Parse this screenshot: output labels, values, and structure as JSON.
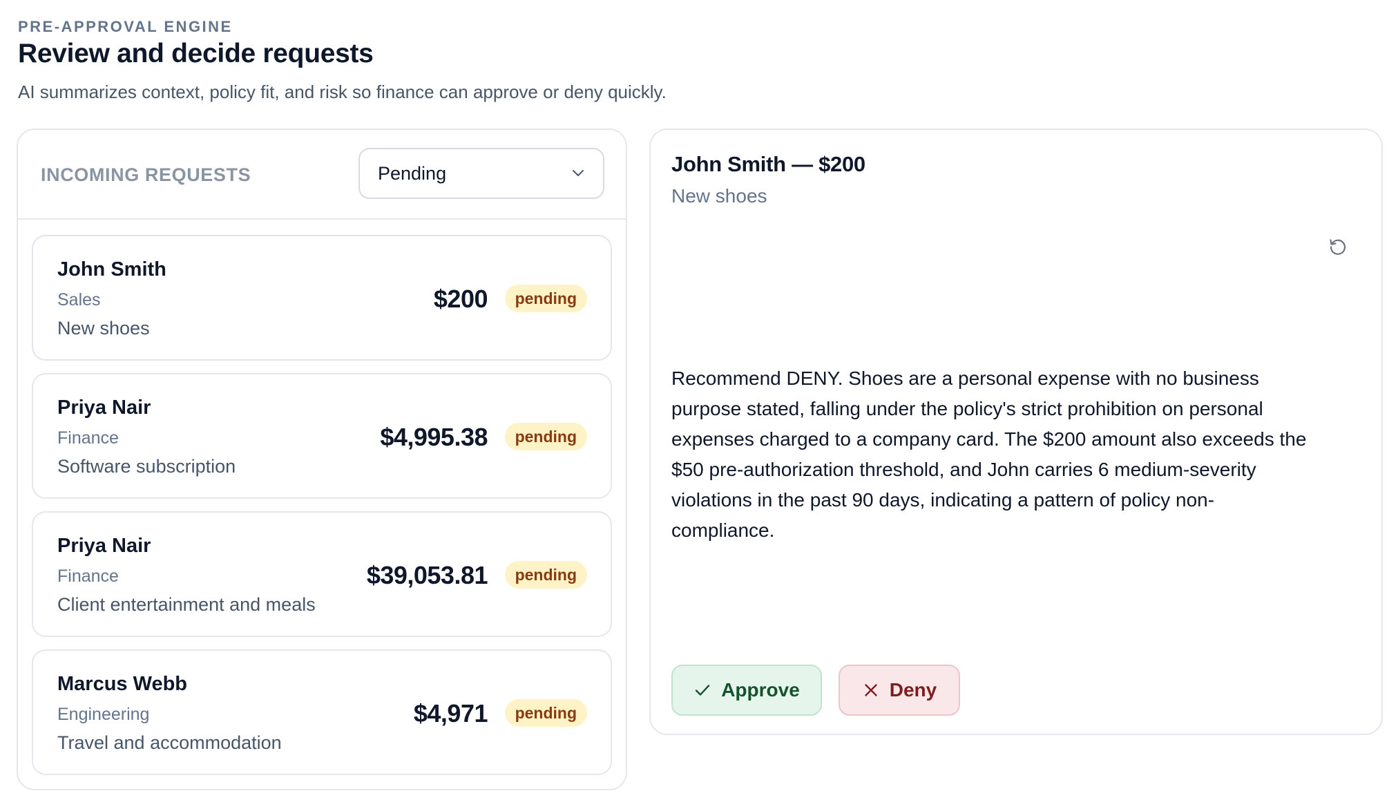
{
  "header": {
    "eyebrow": "PRE-APPROVAL ENGINE",
    "title": "Review and decide requests",
    "subtitle": "AI summarizes context, policy fit, and risk so finance can approve or deny quickly."
  },
  "requests_panel": {
    "heading": "INCOMING REQUESTS",
    "filter": {
      "selected": "Pending",
      "icon": "chevron-down-icon"
    },
    "requests": [
      {
        "name": "John Smith",
        "department": "Sales",
        "purpose": "New shoes",
        "amount": "$200",
        "status": "pending"
      },
      {
        "name": "Priya Nair",
        "department": "Finance",
        "purpose": "Software subscription",
        "amount": "$4,995.38",
        "status": "pending"
      },
      {
        "name": "Priya Nair",
        "department": "Finance",
        "purpose": "Client entertainment and meals",
        "amount": "$39,053.81",
        "status": "pending"
      },
      {
        "name": "Marcus Webb",
        "department": "Engineering",
        "purpose": "Travel and accommodation",
        "amount": "$4,971",
        "status": "pending"
      }
    ]
  },
  "detail": {
    "title": "John Smith — $200",
    "subtitle": "New shoes",
    "refresh_icon": "refresh-icon",
    "recommendation": "Recommend DENY. Shoes are a personal expense with no business purpose stated, falling under the policy's strict prohibition on personal expenses charged to a company card. The $200 amount also exceeds the $50 pre-authorization threshold, and John carries 6 medium-severity violations in the past 90 days, indicating a pattern of policy non-compliance.",
    "approve_label": "Approve",
    "deny_label": "Deny"
  },
  "colors": {
    "badge_bg": "#fdf3c7",
    "badge_text": "#8a3a10",
    "approve_bg": "#e6f5ec",
    "deny_bg": "#f9e7e9"
  }
}
